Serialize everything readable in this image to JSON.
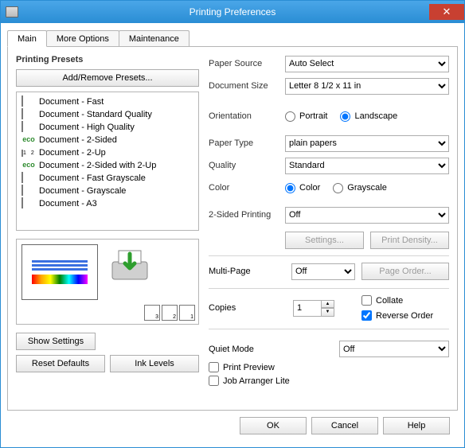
{
  "window": {
    "title": "Printing Preferences"
  },
  "tabs": [
    "Main",
    "More Options",
    "Maintenance"
  ],
  "activeTab": 0,
  "presets": {
    "title": "Printing Presets",
    "manageLabel": "Add/Remove Presets...",
    "items": [
      "Document - Fast",
      "Document - Standard Quality",
      "Document - High Quality",
      "Document - 2-Sided",
      "Document - 2-Up",
      "Document - 2-Sided with 2-Up",
      "Document - Fast Grayscale",
      "Document - Grayscale",
      "Document - A3"
    ]
  },
  "buttons": {
    "showSettings": "Show Settings",
    "resetDefaults": "Reset Defaults",
    "inkLevels": "Ink Levels",
    "settings": "Settings...",
    "printDensity": "Print Density...",
    "pageOrder": "Page Order...",
    "ok": "OK",
    "cancel": "Cancel",
    "help": "Help"
  },
  "labels": {
    "paperSource": "Paper Source",
    "documentSize": "Document Size",
    "orientation": "Orientation",
    "portrait": "Portrait",
    "landscape": "Landscape",
    "paperType": "Paper Type",
    "quality": "Quality",
    "color": "Color",
    "colorOpt": "Color",
    "grayscale": "Grayscale",
    "twoSided": "2-Sided Printing",
    "multiPage": "Multi-Page",
    "copies": "Copies",
    "collate": "Collate",
    "reverse": "Reverse Order",
    "quiet": "Quiet Mode",
    "printPreview": "Print Preview",
    "jobArranger": "Job Arranger Lite"
  },
  "values": {
    "paperSource": "Auto Select",
    "documentSize": "Letter 8 1/2 x 11 in",
    "orientation": "landscape",
    "paperType": "plain papers",
    "quality": "Standard",
    "colorMode": "color",
    "twoSided": "Off",
    "multiPage": "Off",
    "copies": "1",
    "collate": false,
    "reverse": true,
    "quiet": "Off",
    "printPreview": false,
    "jobArranger": false
  }
}
